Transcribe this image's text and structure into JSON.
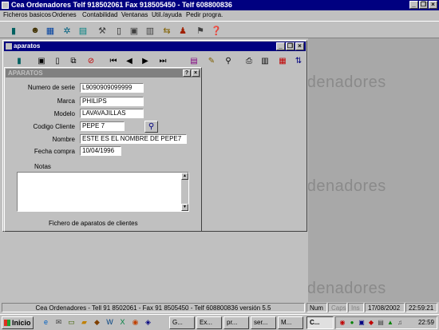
{
  "app": {
    "title": "Cea Ordenadores Telf 918502061 Fax 918505450 - Telf 608800836"
  },
  "window_buttons": {
    "minimize": "_",
    "restore": "❐",
    "close": "×"
  },
  "menu": [
    "Ficheros basicos",
    "Ordenes",
    "Contabilidad",
    "Ventanas",
    "Util./ayuda",
    "Pedir progra."
  ],
  "main_toolbar_icons": [
    "book-icon",
    "person-icon",
    "grid-icon",
    "gear-icon",
    "chart-icon",
    "tools-icon",
    "document-icon",
    "window-icon",
    "printer-icon",
    "window2-icon",
    "transfer-icon",
    "people-icon",
    "shopping-icon",
    "help-icon"
  ],
  "child": {
    "title": "aparatos",
    "toolbar_icons": [
      "book",
      "save",
      "new-doc",
      "copy",
      "delete",
      "first",
      "prev",
      "next",
      "last",
      "form",
      "edit",
      "find",
      "print",
      "printer",
      "table",
      "sort-asc",
      "sort-desc"
    ]
  },
  "form": {
    "title": "APARATOS",
    "help_btn": "?",
    "close_btn": "×",
    "fields": {
      "serie_label": "Numero de serie",
      "serie_value": "L9090909099999",
      "marca_label": "Marca",
      "marca_value": "PHILIPS",
      "modelo_label": "Modelo",
      "modelo_value": "LAVAVAJILLAS",
      "cliente_label": "Codigo Cliente",
      "cliente_value": "PEPE  7",
      "nombre_label": "Nombre",
      "nombre_value": "ESTE ES EL NOMBRE DE PEPE7",
      "fecha_label": "Fecha compra",
      "fecha_value": "10/04/1996",
      "notas_label": "Notas",
      "notas_value": ""
    },
    "footer": "Fichero de aparatos de clientes"
  },
  "desktop_watermark": "ordenadores",
  "status": {
    "main": "Cea Ordenadores - Tell 91 8502061 - Fax 91 8505450 - Telf 608800836 versión 5.5",
    "num": "Num",
    "caps": "Caps",
    "ins": "Ins",
    "date": "17/08/2002",
    "time": "22:59:21"
  },
  "taskbar": {
    "start": "Inicio",
    "buttons": [
      "G...",
      "Ex...",
      "pr...",
      "ser...",
      "M...",
      "C..."
    ],
    "clock": "22:59"
  }
}
